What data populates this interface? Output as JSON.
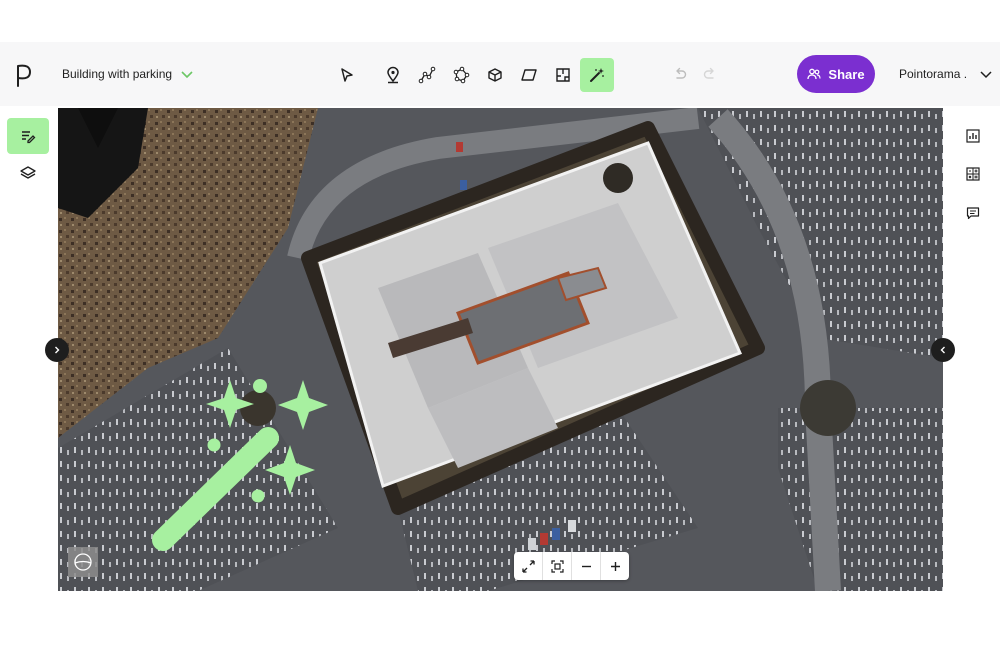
{
  "header": {
    "project_name": "Building with parking",
    "share_label": "Share",
    "account_name": "Pointorama ."
  },
  "colors": {
    "accent_green": "#a7f0a0",
    "brand_purple": "#7b2fd0",
    "topbar_bg": "#f7f7f8"
  },
  "toolbar": {
    "tools": [
      {
        "icon": "select-arrow-icon"
      },
      {
        "icon": "map-pin-icon"
      },
      {
        "icon": "polyline-icon"
      },
      {
        "icon": "polygon-icon"
      },
      {
        "icon": "cube-icon"
      },
      {
        "icon": "plane-icon"
      },
      {
        "icon": "floor-plan-icon"
      },
      {
        "icon": "magic-wand-icon",
        "active": true
      }
    ],
    "history": [
      {
        "icon": "undo-icon"
      },
      {
        "icon": "redo-icon"
      }
    ]
  },
  "left_sidebar": [
    {
      "icon": "notes-edit-icon",
      "active": true
    },
    {
      "icon": "layers-icon"
    }
  ],
  "right_sidebar": [
    {
      "icon": "bar-chart-icon"
    },
    {
      "icon": "calculator-icon"
    },
    {
      "icon": "comment-icon"
    }
  ],
  "viewport_controls": [
    {
      "icon": "fullscreen-icon"
    },
    {
      "icon": "fit-to-view-icon"
    },
    {
      "icon": "zoom-out-icon"
    },
    {
      "icon": "zoom-in-icon"
    }
  ]
}
